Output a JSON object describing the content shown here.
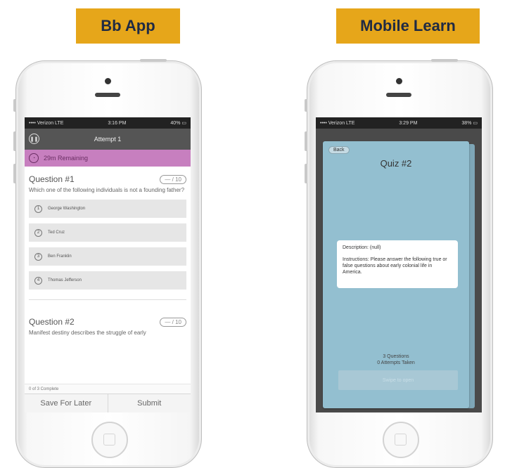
{
  "labels": {
    "left": "Bb App",
    "right": "Mobile Learn"
  },
  "colors": {
    "label_bg": "#e6a61a",
    "label_text": "#1f2a44",
    "timer_bar": "#c77fbf",
    "quiz_card": "#93bfd0"
  },
  "left_phone": {
    "status": {
      "carrier": "•••• Verizon  LTE",
      "time": "3:16 PM",
      "battery": "40%"
    },
    "header": {
      "title": "Attempt 1",
      "pause_icon": "pause-icon"
    },
    "timer": {
      "icon": "clock-icon",
      "text": "29m Remaining"
    },
    "question1": {
      "title": "Question #1",
      "score": "— / 10",
      "text": "Which one of the following individuals is not a founding father?",
      "options": [
        {
          "num": "1",
          "label": "George Washington"
        },
        {
          "num": "2",
          "label": "Ted Cruz"
        },
        {
          "num": "3",
          "label": "Ben Franklin"
        },
        {
          "num": "4",
          "label": "Thomas Jefferson"
        }
      ]
    },
    "question2": {
      "title": "Question #2",
      "score": "— / 10",
      "text": "Manifest destiny describes the struggle of early"
    },
    "progress": "0 of 3 Complete",
    "actions": {
      "save": "Save For Later",
      "submit": "Submit"
    }
  },
  "right_phone": {
    "status": {
      "carrier": "•••• Verizon  LTE",
      "time": "3:29 PM",
      "battery": "38%"
    },
    "back": "Back",
    "quiz_title": "Quiz #2",
    "description": "Description: (null)",
    "instructions": "Instructions: Please answer the following true or false questions about early colonial life in America.",
    "questions_count": "3 Questions",
    "attempts_taken": "0 Attempts Taken",
    "begin": "Swipe to open"
  }
}
